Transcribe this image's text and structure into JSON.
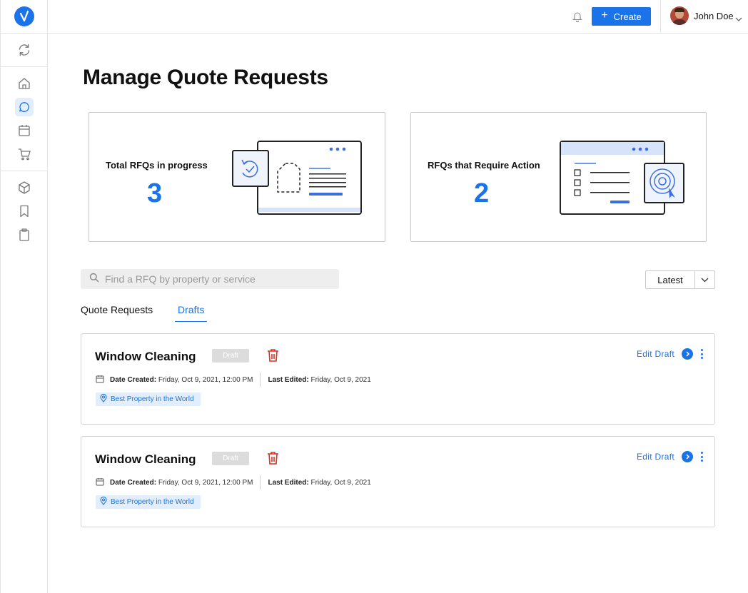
{
  "header": {
    "create_label": "Create",
    "user_name": "John Doe"
  },
  "sidebar": {
    "items": [
      {
        "icon": "refresh-icon"
      },
      {
        "icon": "home-icon"
      },
      {
        "icon": "chat-icon",
        "active": true
      },
      {
        "icon": "calendar-icon"
      },
      {
        "icon": "cart-icon"
      },
      {
        "icon": "box-icon"
      },
      {
        "icon": "bookmark-icon"
      },
      {
        "icon": "clipboard-icon"
      }
    ]
  },
  "page": {
    "title": "Manage Quote Requests"
  },
  "stats": [
    {
      "label": "Total RFQs in progress",
      "value": "3"
    },
    {
      "label": "RFQs that Require Action",
      "value": "2"
    }
  ],
  "search": {
    "placeholder": "Find a RFQ by property or service"
  },
  "sort": {
    "selected": "Latest"
  },
  "tabs": [
    {
      "label": "Quote Requests",
      "active": false
    },
    {
      "label": "Drafts",
      "active": true
    }
  ],
  "drafts": [
    {
      "title": "Window Cleaning",
      "badge": "Draft",
      "date_created_label": "Date Created:",
      "date_created": "Friday, Oct 9, 2021, 12:00 PM",
      "last_edited_label": "Last Edited:",
      "last_edited": "Friday, Oct 9, 2021",
      "property": "Best Property in the World",
      "edit_label": "Edit Draft"
    },
    {
      "title": "Window Cleaning",
      "badge": "Draft",
      "date_created_label": "Date Created:",
      "date_created": "Friday, Oct 9, 2021, 12:00 PM",
      "last_edited_label": "Last Edited:",
      "last_edited": "Friday, Oct 9, 2021",
      "property": "Best Property in the World",
      "edit_label": "Edit Draft"
    }
  ],
  "colors": {
    "accent": "#1a73e8",
    "danger": "#d93025",
    "badge_bg": "#dcdcdc",
    "chip_bg": "#e3eefc"
  }
}
